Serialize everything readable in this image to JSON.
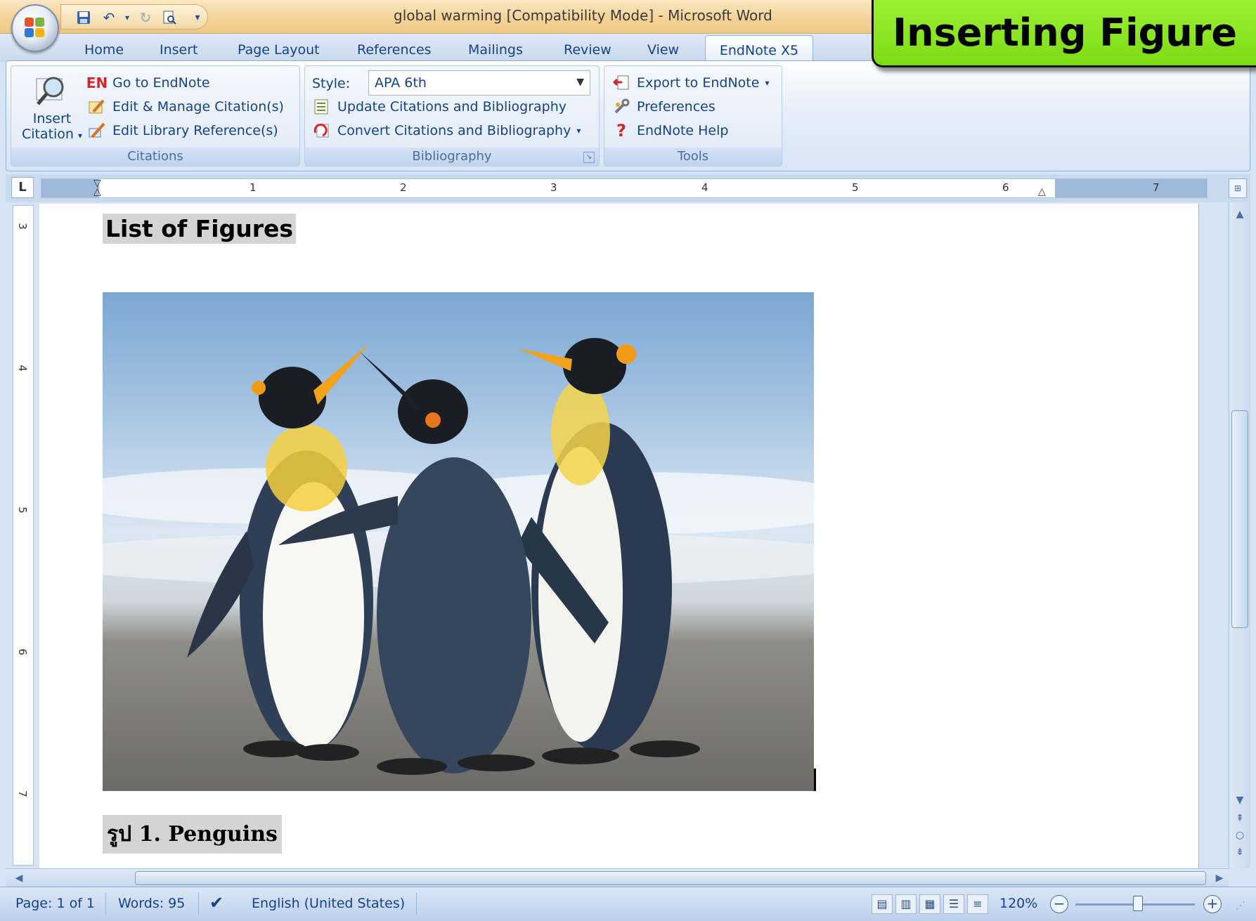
{
  "window": {
    "title": "global warming [Compatibility Mode] - Microsoft Word",
    "overlay_label": "Inserting Figure"
  },
  "tabs": [
    {
      "label": "Home"
    },
    {
      "label": "Insert"
    },
    {
      "label": "Page Layout"
    },
    {
      "label": "References"
    },
    {
      "label": "Mailings"
    },
    {
      "label": "Review"
    },
    {
      "label": "View"
    },
    {
      "label": "EndNote X5",
      "active": true
    }
  ],
  "ribbon": {
    "citations": {
      "label": "Citations",
      "insert_citation_1": "Insert",
      "insert_citation_2": "Citation",
      "goto_prefix": "EN",
      "goto": "Go to EndNote",
      "edit_manage": "Edit & Manage Citation(s)",
      "edit_library": "Edit Library Reference(s)"
    },
    "bibliography": {
      "label": "Bibliography",
      "style_label": "Style:",
      "style_value": "APA 6th",
      "update": "Update Citations and Bibliography",
      "convert": "Convert Citations and Bibliography"
    },
    "tools": {
      "label": "Tools",
      "export": "Export to EndNote",
      "preferences": "Preferences",
      "help": "EndNote Help"
    }
  },
  "ruler": {
    "h_numbers": [
      "1",
      "2",
      "3",
      "4",
      "5",
      "6",
      "7"
    ],
    "v_numbers": [
      "3",
      "4",
      "5",
      "6",
      "7"
    ]
  },
  "document": {
    "heading": "List of Figures",
    "caption": "รูป 1. Penguins"
  },
  "status": {
    "page": "Page: 1 of 1",
    "words": "Words: 95",
    "language": "English (United States)",
    "zoom": "120%"
  },
  "colors": {
    "overlay_green": "#7ddb14",
    "ribbon_text": "#15428b",
    "title_bar": "#f4d398"
  }
}
